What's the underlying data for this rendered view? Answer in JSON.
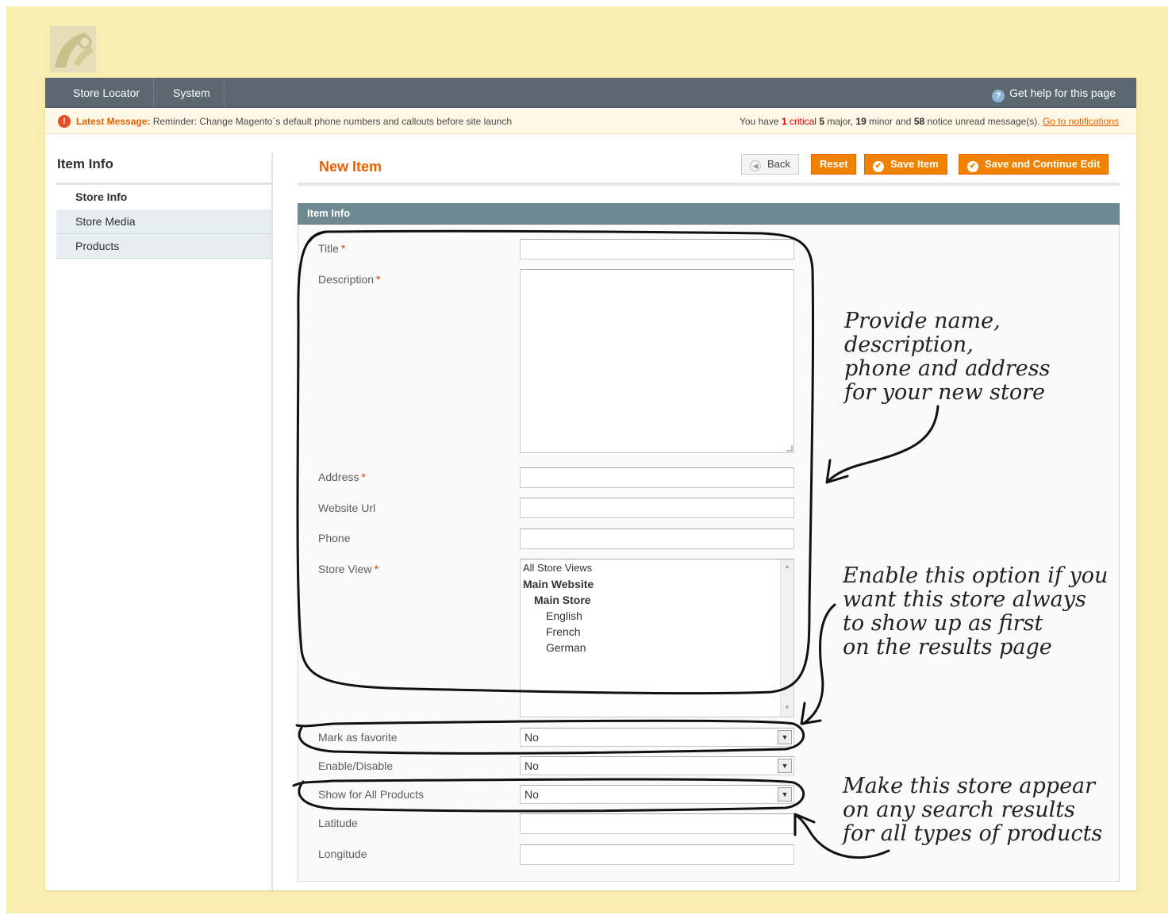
{
  "nav": {
    "items": [
      "Store Locator",
      "System"
    ],
    "help": "Get help for this page"
  },
  "notice": {
    "latest_label": "Latest Message:",
    "latest_text": "Reminder: Change Magento`s default phone numbers and callouts before site launch",
    "summary_prefix": "You have",
    "critical_count": "1",
    "critical_word": "critical",
    "major_count": "5",
    "major_word": "major,",
    "minor_count": "19",
    "minor_word": "minor and",
    "notice_count": "58",
    "notice_word": "notice unread message(s).",
    "link": "Go to notifications"
  },
  "sidebar": {
    "title": "Item Info",
    "items": [
      {
        "label": "Store Info"
      },
      {
        "label": "Store Media"
      },
      {
        "label": "Products"
      }
    ]
  },
  "page": {
    "title": "New Item",
    "buttons": {
      "back": "Back",
      "reset": "Reset",
      "save": "Save Item",
      "save_continue": "Save and Continue Edit"
    }
  },
  "form": {
    "section_title": "Item Info",
    "title_label": "Title",
    "description_label": "Description",
    "address_label": "Address",
    "website_label": "Website Url",
    "phone_label": "Phone",
    "store_view_label": "Store View",
    "store_view_options": [
      "All Store Views",
      "Main Website",
      "Main Store",
      "English",
      "French",
      "German"
    ],
    "favorite_label": "Mark as favorite",
    "favorite_value": "No",
    "enable_label": "Enable/Disable",
    "enable_value": "No",
    "show_all_label": "Show for All Products",
    "show_all_value": "No",
    "latitude_label": "Latitude",
    "longitude_label": "Longitude",
    "required_mark": "*"
  },
  "annotations": {
    "note1": [
      "Provide name,",
      "description,",
      "phone and address",
      "for your new store"
    ],
    "note2": [
      "Enable this option if you",
      "want this store always",
      "to show up as first",
      "on the results page"
    ],
    "note3": [
      "Make this store appear",
      "on any search results",
      "for all types of products"
    ]
  },
  "colors": {
    "background": "#faedb0",
    "accent": "#eb5e00",
    "button": "#f18200",
    "navbar": "#5b6870",
    "section_header": "#6f8992"
  }
}
